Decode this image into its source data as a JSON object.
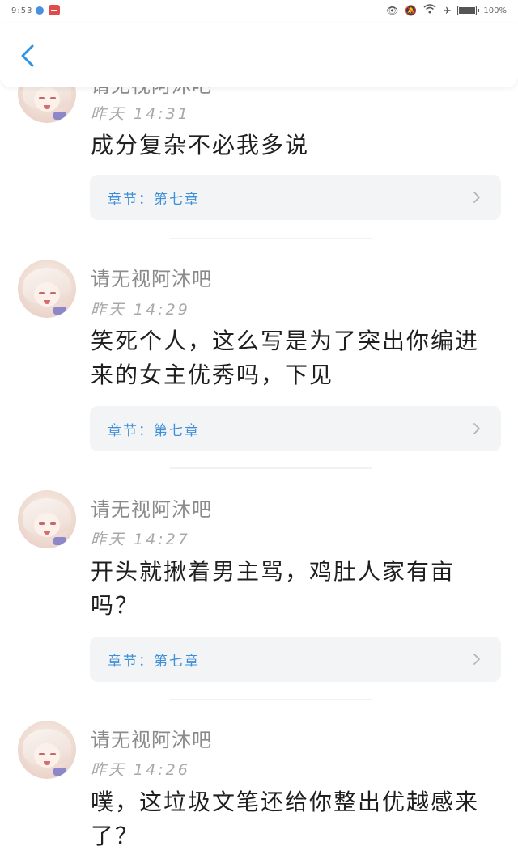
{
  "status_bar": {
    "time": "9:53",
    "battery_pct": "100%"
  },
  "comments": [
    {
      "username": "请无视阿沐吧",
      "time": "昨天 14:31",
      "content": "成分复杂不必我多说",
      "chapter_label": "章节：第七章"
    },
    {
      "username": "请无视阿沐吧",
      "time": "昨天 14:29",
      "content": "笑死个人，这么写是为了突出你编进来的女主优秀吗，下见",
      "chapter_label": "章节：第七章"
    },
    {
      "username": "请无视阿沐吧",
      "time": "昨天 14:27",
      "content": "开头就揪着男主骂，鸡肚人家有亩吗？",
      "chapter_label": "章节：第七章"
    },
    {
      "username": "请无视阿沐吧",
      "time": "昨天 14:26",
      "content": "噗，这垃圾文笔还给你整出优越感来了？"
    }
  ],
  "colors": {
    "accent": "#3e8fd8",
    "chapter_bg": "#f3f4f6"
  }
}
